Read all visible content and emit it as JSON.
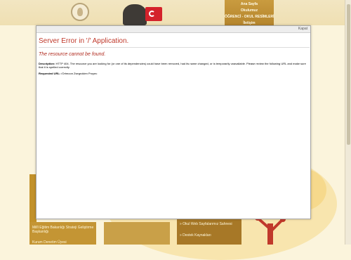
{
  "page": {
    "nav_items": [
      "Ana Sayfa",
      "Okulumuz",
      "ÖĞRENCİ - OKUL RESİMLERİ",
      "İletişim"
    ],
    "left_box": {
      "text": "Millî Eğitim Bakanlığı Strateji Geliştirme Başkanlığı",
      "text2": "Kurum Denetim Üyesi"
    },
    "right_box": {
      "link1": "» Okul Web Sayfalarımız Sahnesi",
      "link2": "» Destek Kaynakları"
    }
  },
  "modal": {
    "close_label": "Kapat",
    "title": "Server Error in '/' Application.",
    "subtitle": "The resource cannot be found.",
    "description_label": "Description:",
    "description_text": "HTTP 404. The resource you are looking for (or one of its dependencies) could have been removed, had its name changed, or is temporarily unavailable.  Please review the following URL and make sure that it is spelled correctly.",
    "url_label": "Requested URL:",
    "url_value": "/Ortmoon Zsegrokien Proyec"
  },
  "colors": {
    "error_title": "#c0392b",
    "page_background": "#fbf4dc",
    "nav_background": "#b5852d"
  }
}
